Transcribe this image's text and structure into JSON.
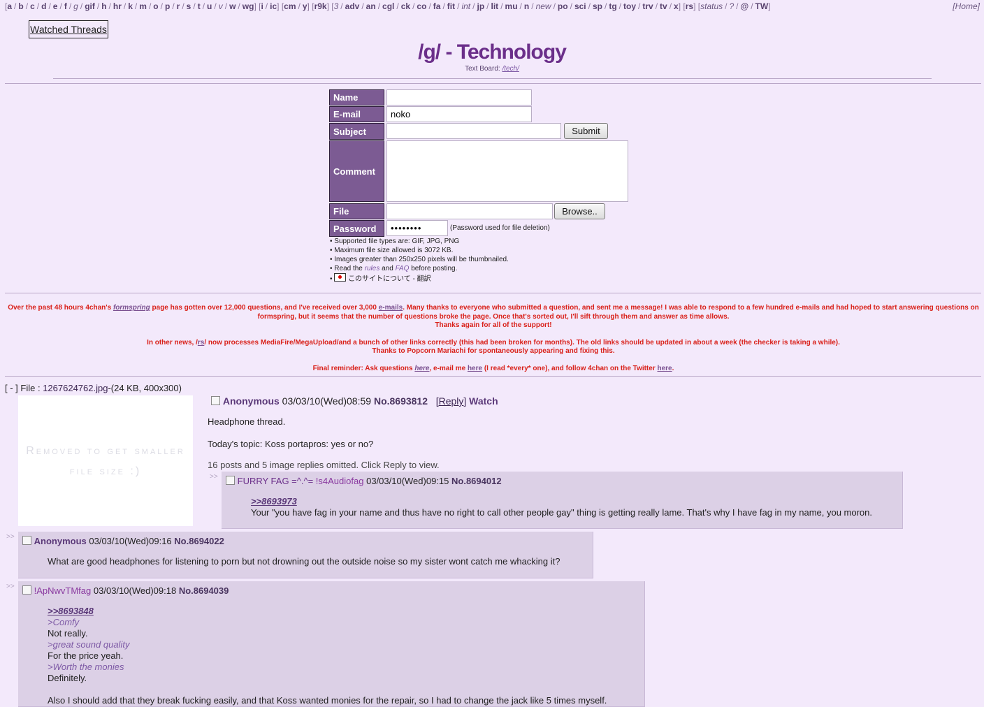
{
  "nav": {
    "groups": [
      [
        "a",
        "b",
        "c",
        "d",
        "e",
        "f",
        "g",
        "gif",
        "h",
        "hr",
        "k",
        "m",
        "o",
        "p",
        "r",
        "s",
        "t",
        "u",
        "v",
        "w",
        "wg"
      ],
      [
        "i",
        "ic"
      ],
      [
        "cm",
        "y"
      ],
      [
        "r9k"
      ],
      [
        "3",
        "adv",
        "an",
        "cgl",
        "ck",
        "co",
        "fa",
        "fit",
        "int",
        "jp",
        "lit",
        "mu",
        "n",
        "new",
        "po",
        "sci",
        "sp",
        "tg",
        "toy",
        "trv",
        "tv",
        "x"
      ],
      [
        "rs"
      ],
      [
        "status",
        "?",
        "@",
        "TW"
      ]
    ],
    "home": "Home"
  },
  "watched_threads": "Watched Threads",
  "board": {
    "title": "/g/ - Technology",
    "subtitle_prefix": "Text Board: ",
    "subtitle_link": "/tech/"
  },
  "post_form": {
    "name_label": "Name",
    "email_label": "E-mail",
    "email_value": "noko",
    "subject_label": "Subject",
    "submit": "Submit",
    "comment_label": "Comment",
    "file_label": "File",
    "browse": "Browse..",
    "password_label": "Password",
    "password_value": "••••••••",
    "password_note": "(Password used for file deletion)",
    "rules": [
      "• Supported file types are: GIF, JPG, PNG",
      "• Maximum file size allowed is 3072 KB.",
      "• Images greater than 250x250 pixels will be thumbnailed."
    ],
    "rules_read_prefix": "• Read the ",
    "rules_link": "rules",
    "rules_and": " and ",
    "faq_link": "FAQ",
    "rules_read_suffix": " before posting.",
    "japan_text": "このサイトについて - 翻訳"
  },
  "news": {
    "p1_a": "Over the past 48 hours 4chan's ",
    "p1_link": "formspring",
    "p1_b": " page has gotten over 12,000 questions, and I've received over 3,000 ",
    "p1_link2": "e-mails",
    "p1_c": ". Many thanks to everyone who submitted a question, and sent me a message! I was able to respond to a few hundred e-mails and had hoped to start answering questions on formspring, but it seems that the number of questions broke the page. Once that's sorted out, I'll sift through them and answer as time allows.",
    "p1_d": "Thanks again for all of the support!",
    "p2_a": "In other news, /",
    "p2_link": "rs",
    "p2_b": "/ now processes MediaFire/MegaUpload/and a bunch of other links correctly (this had been broken for months). The old links should be updated in about a week (the checker is taking a while).",
    "p2_c": "Thanks to Popcorn Mariachi for spontaneously appearing and fixing this.",
    "p3_a": "Final reminder: Ask questions ",
    "p3_link": "here",
    "p3_b": ", e-mail me ",
    "p3_link2": "here",
    "p3_c": " (I read *every* one), and follow 4chan on the Twitter ",
    "p3_link3": "here",
    "p3_d": "."
  },
  "thread": {
    "collapse": "[ - ]",
    "file_prefix": " File : ",
    "file_name": "1267624762.jpg",
    "file_info": "-(24 KB, 400x300)",
    "thumb_text": "Removed to get smaller file size :)",
    "op": {
      "name": "Anonymous",
      "date": "03/03/10(Wed)08:59",
      "no": "No.8693812",
      "reply": "Reply",
      "watch": "Watch",
      "lines": [
        "Headphone thread.",
        "",
        "Today's topic: Koss portapros: yes or no?"
      ],
      "omitted": "16 posts and 5 image replies omitted. Click Reply to view."
    },
    "replies": [
      {
        "name": "FURRY FAG =^.^=",
        "trip": "!s4Audiofag",
        "date": "03/03/10(Wed)09:15",
        "no": "No.8694012",
        "quote": ">>8693973",
        "text": "Your \"you have fag in your name and thus have no right to call other people gay\" thing is getting really lame. That's why I have fag in my name, you moron."
      },
      {
        "name": "Anonymous",
        "date": "03/03/10(Wed)09:16",
        "no": "No.8694022",
        "text": "What are good headphones for listening to porn but not drowning out the outside noise so my sister wont catch me whacking it?"
      },
      {
        "trip": "!ApNwvTMfag",
        "date": "03/03/10(Wed)09:18",
        "no": "No.8694039",
        "quote": ">>8693848",
        "g1": ">Comfy",
        "t1": "Not really.",
        "g2": ">great sound quality",
        "t2": "For the price yeah.",
        "g3": ">Worth the monies",
        "t3": "Definitely.",
        "t4": "Also I should add that they break fucking easily, and that Koss wanted monies for the repair, so I had to change the jack like 5 times myself."
      }
    ],
    "arrow": ">>"
  }
}
